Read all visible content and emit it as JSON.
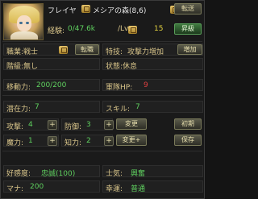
{
  "character": {
    "name": "フレイヤ",
    "location": "メシアの森(8,6)",
    "exp_label": "経験:",
    "exp_value": "0/47.6k",
    "lv_label": "/Lv:",
    "lv_value": "15",
    "job_label": "職業:戦士",
    "class_label": "階級:無し",
    "stamina_label": "移動力:",
    "stamina_value": "200/200",
    "special_label": "特技:",
    "special_value": "攻撃力増加",
    "status_label": "状態:休息",
    "army_label": "軍隊HP:",
    "army_value": "9",
    "potential_label": "潜在力:",
    "potential_value": "7",
    "skill_label": "スキル:",
    "skill_value": "7",
    "attack_label": "攻撃:",
    "attack_value": "4",
    "defense_label": "防御:",
    "defense_value": "3",
    "magic_label": "魔力:",
    "magic_value": "1",
    "intel_label": "知力:",
    "intel_value": "2",
    "affinity_label": "好感度:",
    "affinity_value": "忠誠(100)",
    "morale_label": "士気:",
    "morale_value": "興奮",
    "mana_label": "マナ:",
    "mana_value": "200",
    "luck_label": "幸運:",
    "luck_value": "普通"
  },
  "buttons": {
    "transfer": "転送",
    "promote": "昇級",
    "change_job": "転職",
    "increase": "増加",
    "change1": "変更",
    "init": "初期",
    "change2": "変更+",
    "save": "保存"
  },
  "icons": {
    "seal": "seal-icon",
    "plus": "+"
  }
}
